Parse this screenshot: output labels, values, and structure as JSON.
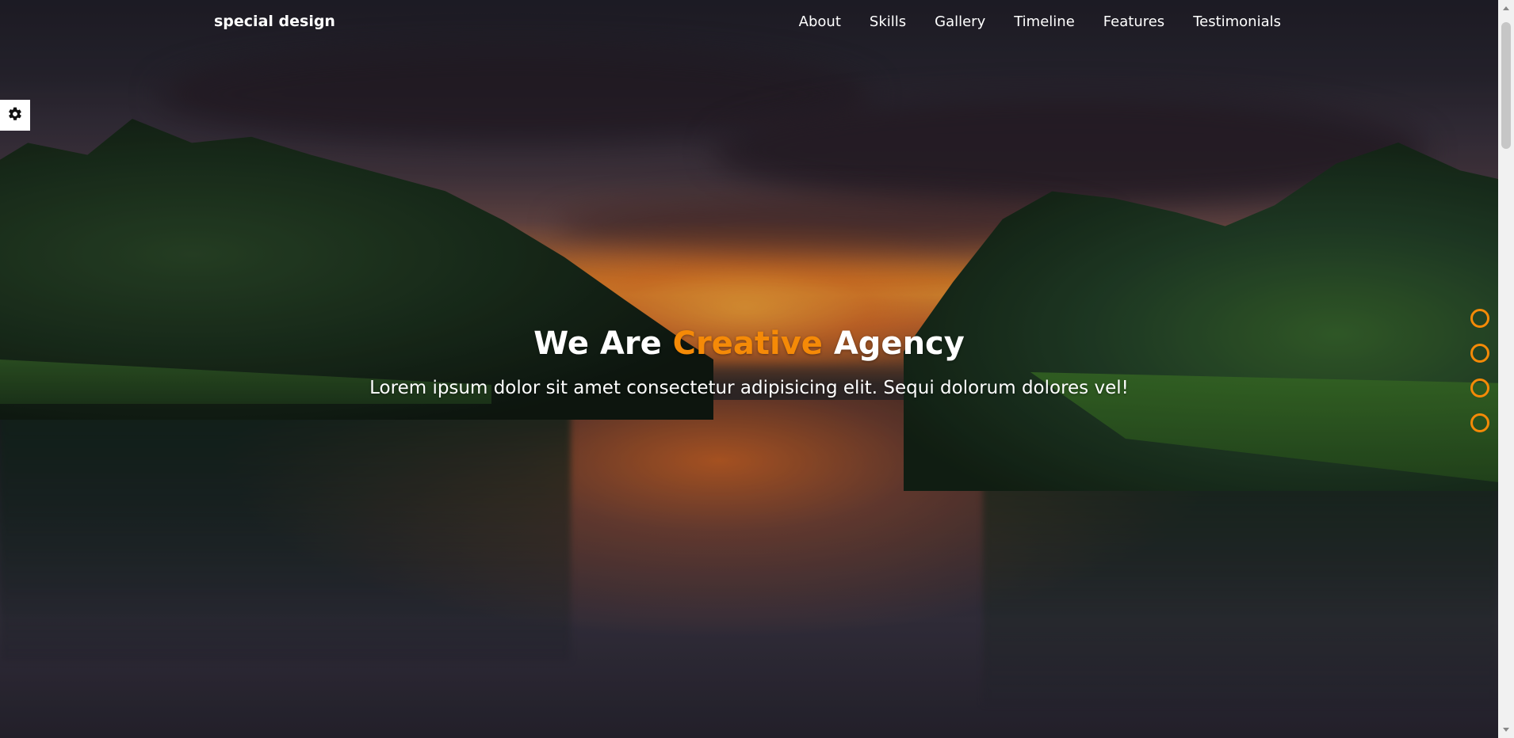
{
  "header": {
    "logo": "special design",
    "nav": [
      {
        "label": "About"
      },
      {
        "label": "Skills"
      },
      {
        "label": "Gallery"
      },
      {
        "label": "Timeline"
      },
      {
        "label": "Features"
      },
      {
        "label": "Testimonials"
      }
    ]
  },
  "hero": {
    "title_part1": "We Are",
    "title_accent": "Creative",
    "title_part2": "Agency",
    "text": "Lorem ipsum dolor sit amet consectetur adipisicing elit. Sequi dolorum dolores vel!"
  },
  "settings": {
    "icon": "gear-icon"
  },
  "bullets": {
    "count": 4
  },
  "colors": {
    "accent": "#f58a07",
    "text": "#ffffff",
    "settings_bg": "#ffffff"
  }
}
